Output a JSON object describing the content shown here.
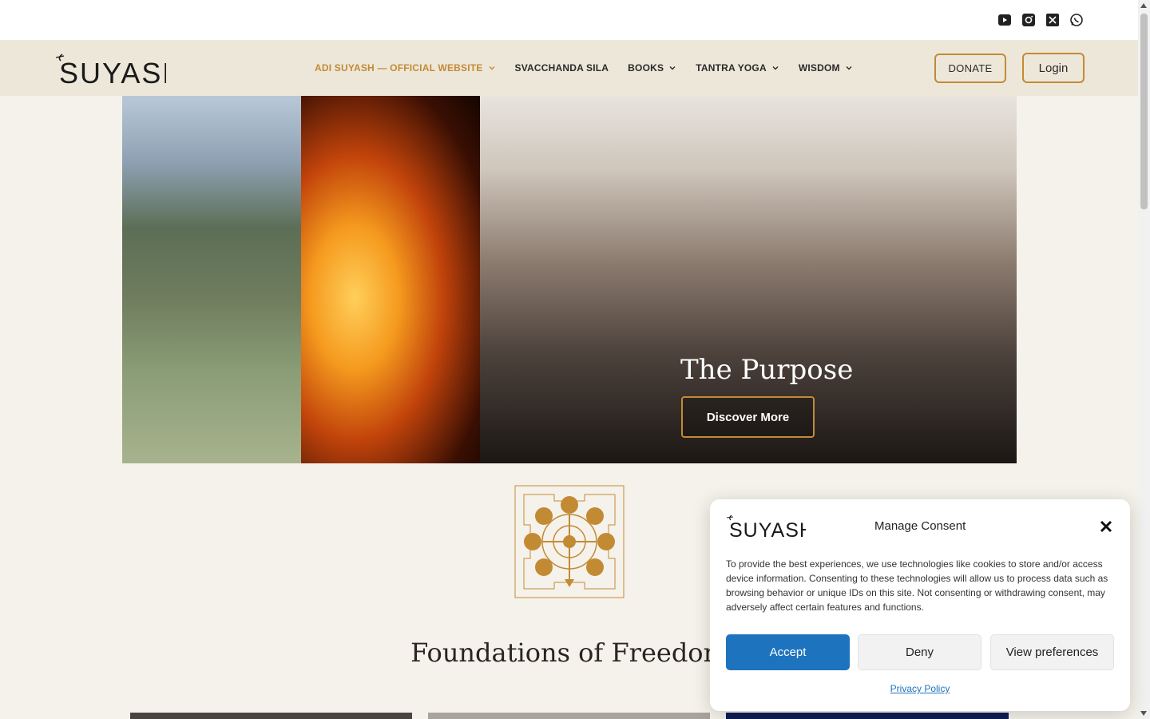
{
  "topbar": {
    "social": [
      {
        "icon": "youtube-icon"
      },
      {
        "icon": "instagram-icon"
      },
      {
        "icon": "x-twitter-icon"
      },
      {
        "icon": "whatsapp-icon"
      }
    ]
  },
  "header": {
    "logo_text": "SUYASH",
    "nav": [
      {
        "label": "ADI SUYASH — OFFICIAL WEBSITE",
        "has_dropdown": true,
        "active": true
      },
      {
        "label": "SVACCHANDA SILA",
        "has_dropdown": false,
        "active": false
      },
      {
        "label": "BOOKS",
        "has_dropdown": true,
        "active": false
      },
      {
        "label": "TANTRA YOGA",
        "has_dropdown": true,
        "active": false
      },
      {
        "label": "WISDOM",
        "has_dropdown": true,
        "active": false
      }
    ],
    "donate_label": "DONATE",
    "login_label": "Login"
  },
  "hero": {
    "title": "The Purpose",
    "button_label": "Discover More"
  },
  "section": {
    "title": "Foundations of Freedom"
  },
  "consent": {
    "logo_text": "SUYASH",
    "title": "Manage Consent",
    "body": "To provide the best experiences, we use technologies like cookies to store and/or access device information. Consenting to these technologies will allow us to process data such as browsing behavior or unique IDs on this site. Not consenting or withdrawing consent, may adversely affect certain features and functions.",
    "accept_label": "Accept",
    "deny_label": "Deny",
    "preferences_label": "View preferences",
    "policy_link": "Privacy Policy"
  },
  "colors": {
    "accent": "#c38a34",
    "header_bg": "#ede7da",
    "page_bg": "#f5f2eb",
    "consent_primary": "#1e73be"
  }
}
